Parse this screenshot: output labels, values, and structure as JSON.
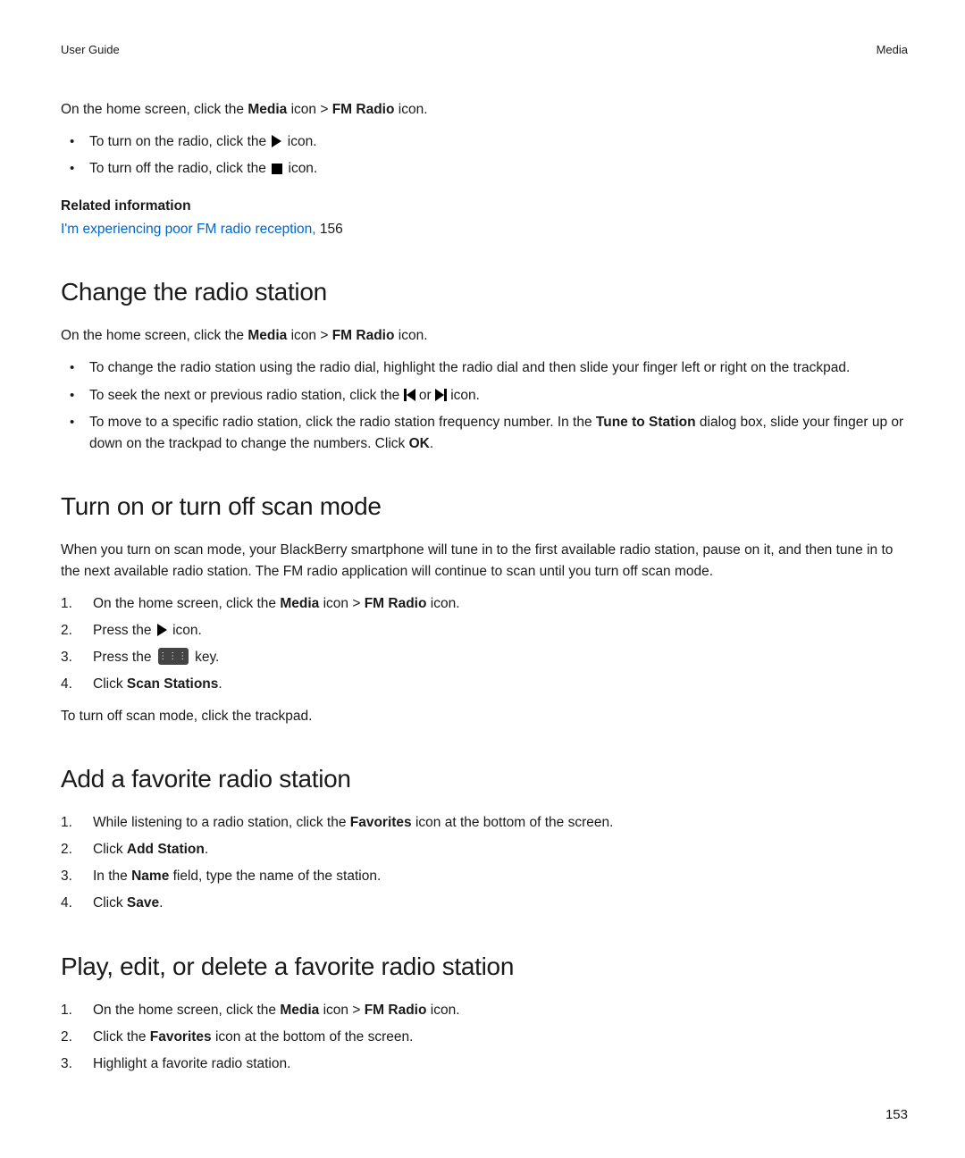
{
  "header": {
    "left": "User Guide",
    "right": "Media"
  },
  "page_number": "153",
  "intro": {
    "p1_a": "On the home screen, click the ",
    "p1_b": " icon > ",
    "p1_c": " icon.",
    "media": "Media",
    "fmradio": "FM Radio",
    "b1_a": "To turn on the radio, click the ",
    "b1_b": " icon.",
    "b2_a": "To turn off the radio, click the ",
    "b2_b": " icon."
  },
  "related": {
    "heading": "Related information",
    "link": "I'm experiencing poor FM radio reception,",
    "page": " 156"
  },
  "sec1": {
    "title": "Change the radio station",
    "p_a": "On the home screen, click the ",
    "p_b": " icon > ",
    "p_c": " icon.",
    "media": "Media",
    "fmradio": "FM Radio",
    "b1": "To change the radio station using the radio dial, highlight the radio dial and then slide your finger left or right on the trackpad.",
    "b2_a": "To seek the next or previous radio station, click the ",
    "b2_b": " or ",
    "b2_c": " icon.",
    "b3_a": "To move to a specific radio station, click the radio station frequency number. In the ",
    "b3_tune": "Tune to Station",
    "b3_b": " dialog box, slide your finger up or down on the trackpad to change the numbers. Click ",
    "b3_ok": "OK",
    "b3_c": "."
  },
  "sec2": {
    "title": "Turn on or turn off scan mode",
    "p1": "When you turn on scan mode, your BlackBerry smartphone will tune in to the first available radio station, pause on it, and then tune in to the next available radio station. The FM radio application will continue to scan until you turn off scan mode.",
    "s1_a": "On the home screen, click the ",
    "s1_b": " icon > ",
    "s1_c": " icon.",
    "media": "Media",
    "fmradio": "FM Radio",
    "s2_a": "Press the ",
    "s2_b": " icon.",
    "s3_a": "Press the ",
    "s3_b": " key.",
    "s4_a": "Click ",
    "s4_b": ".",
    "scan": "Scan Stations",
    "p2": "To turn off scan mode, click the trackpad."
  },
  "sec3": {
    "title": "Add a favorite radio station",
    "s1_a": "While listening to a radio station, click the ",
    "s1_b": " icon at the bottom of the screen.",
    "favorites": "Favorites",
    "s2_a": "Click ",
    "s2_b": ".",
    "add": "Add Station",
    "s3_a": "In the ",
    "s3_b": " field, type the name of the station.",
    "name": "Name",
    "s4_a": "Click ",
    "s4_b": ".",
    "save": "Save"
  },
  "sec4": {
    "title": "Play, edit, or delete a favorite radio station",
    "s1_a": "On the home screen, click the ",
    "s1_b": " icon > ",
    "s1_c": " icon.",
    "media": "Media",
    "fmradio": "FM Radio",
    "s2_a": "Click the ",
    "s2_b": " icon at the bottom of the screen.",
    "favorites": "Favorites",
    "s3": "Highlight a favorite radio station."
  }
}
